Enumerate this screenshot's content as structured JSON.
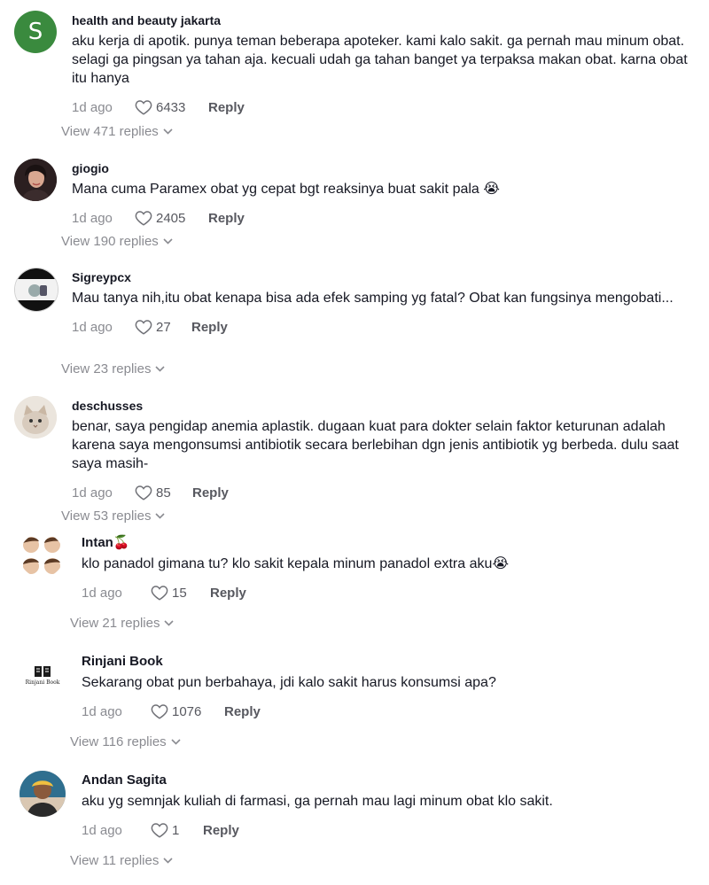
{
  "comments": [
    {
      "username": "health and beauty jakarta",
      "text": "aku kerja di apotik. punya teman beberapa apoteker. kami kalo sakit. ga pernah mau minum obat. selagi ga pingsan ya tahan aja. kecuali udah ga tahan banget ya terpaksa makan obat. karna obat itu hanya",
      "time": "1d ago",
      "likes": "6433",
      "reply_label": "Reply",
      "view_replies": "View 471 replies",
      "avatar_letter": "S",
      "avatar_color": "#3a8a3e"
    },
    {
      "username": "giogio",
      "text": "Mana cuma Paramex obat yg cepat bgt reaksinya buat sakit pala 😭",
      "time": "1d ago",
      "likes": "2405",
      "reply_label": "Reply",
      "view_replies": "View 190 replies"
    },
    {
      "username": "Sigreypcx",
      "text": "Mau tanya nih,itu obat kenapa bisa ada efek samping yg fatal? Obat kan fungsinya mengobati...",
      "time": "1d ago",
      "likes": "27",
      "reply_label": "Reply",
      "view_replies": "View 23 replies"
    },
    {
      "username": "deschusses",
      "text": "benar, saya pengidap anemia aplastik. dugaan kuat para dokter selain faktor keturunan adalah karena saya mengonsumsi antibiotik secara berlebihan dgn jenis antibiotik yg berbeda. dulu saat saya masih-",
      "time": "1d ago",
      "likes": "85",
      "reply_label": "Reply",
      "view_replies": "View 53 replies"
    },
    {
      "username": "Intan🍒",
      "text": "klo panadol gimana tu? klo sakit kepala minum panadol extra aku😭",
      "time": "1d ago",
      "likes": "15",
      "reply_label": "Reply",
      "view_replies": "View 21 replies"
    },
    {
      "username": "Rinjani Book",
      "text": "Sekarang obat pun berbahaya, jdi kalo sakit harus konsumsi apa?",
      "time": "1d ago",
      "likes": "1076",
      "reply_label": "Reply",
      "view_replies": "View 116 replies",
      "avatar_logo_text": "Rinjani Book"
    },
    {
      "username": "Andan Sagita",
      "text": "aku yg semnjak kuliah di farmasi, ga pernah mau lagi minum obat klo sakit.",
      "time": "1d ago",
      "likes": "1",
      "reply_label": "Reply",
      "view_replies": "View 11 replies"
    }
  ],
  "colors": {
    "text_primary": "#161823",
    "text_secondary": "#8a8b91",
    "accent_green": "#3a8a3e"
  },
  "icons": [
    "heart-icon",
    "chevron-down-icon"
  ]
}
